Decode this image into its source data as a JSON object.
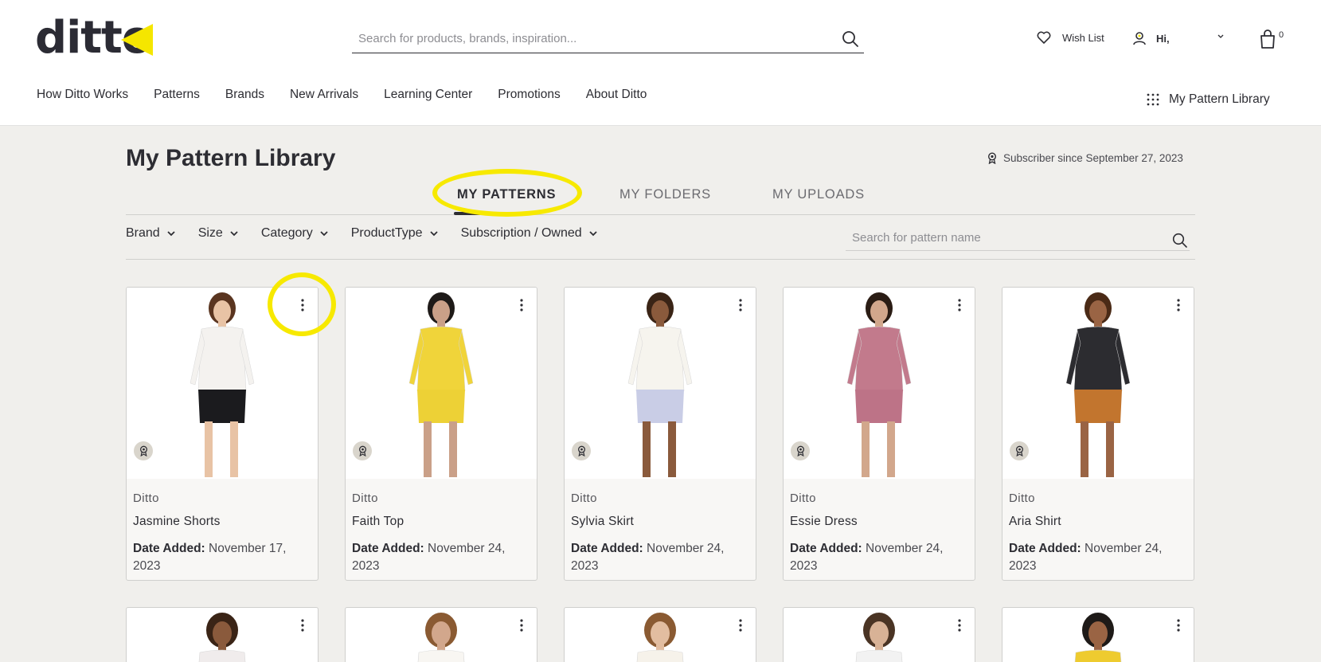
{
  "header": {
    "logo_text": "ditto",
    "search_placeholder": "Search for products, brands, inspiration...",
    "wish_list_label": "Wish List",
    "user_greeting": "Hi,",
    "cart_count": "0",
    "library_link": "My Pattern Library"
  },
  "nav": {
    "items": [
      "How Ditto Works",
      "Patterns",
      "Brands",
      "New Arrivals",
      "Learning Center",
      "Promotions",
      "About Ditto"
    ]
  },
  "page": {
    "title": "My Pattern Library",
    "subscriber_text": "Subscriber since September 27, 2023"
  },
  "tabs": [
    "MY PATTERNS",
    "MY FOLDERS",
    "MY UPLOADS"
  ],
  "filters": [
    "Brand",
    "Size",
    "Category",
    "ProductType",
    "Subscription / Owned"
  ],
  "pattern_search_placeholder": "Search for pattern name",
  "date_label": "Date Added:",
  "patterns": [
    {
      "brand": "Ditto",
      "name": "Jasmine Shorts",
      "date": "November 17, 2023",
      "top_color": "#f4f2ef",
      "bottom_color": "#1b1b1e",
      "skin": "#e8c3a5",
      "hair": "#5a3520"
    },
    {
      "brand": "Ditto",
      "name": "Faith Top",
      "date": "November 24, 2023",
      "top_color": "#f0d43a",
      "bottom_color": "#edd136",
      "skin": "#caa088",
      "hair": "#1e1a18"
    },
    {
      "brand": "Ditto",
      "name": "Sylvia Skirt",
      "date": "November 24, 2023",
      "top_color": "#f6f4ee",
      "bottom_color": "#c9cde6",
      "skin": "#8a5a3c",
      "hair": "#3a2416"
    },
    {
      "brand": "Ditto",
      "name": "Essie Dress",
      "date": "November 24, 2023",
      "top_color": "#c27a8c",
      "bottom_color": "#bd7387",
      "skin": "#d2a78c",
      "hair": "#2a1c14"
    },
    {
      "brand": "Ditto",
      "name": "Aria Shirt",
      "date": "November 24, 2023",
      "top_color": "#2c2c30",
      "bottom_color": "#c2752e",
      "skin": "#9a6444",
      "hair": "#4a2a16"
    }
  ],
  "next_row": [
    {
      "skin": "#8a5a3c",
      "hair": "#3a2416",
      "top_color": "#f0ecec"
    },
    {
      "skin": "#d2a78c",
      "hair": "#8a5a32",
      "top_color": "#f8f6f2"
    },
    {
      "skin": "#e2bda0",
      "hair": "#8a5a32",
      "top_color": "#f6f2ea"
    },
    {
      "skin": "#d8b296",
      "hair": "#4a3424",
      "top_color": "#f2f2f2"
    },
    {
      "skin": "#9a6444",
      "hair": "#1e1a18",
      "top_color": "#eecb2f"
    }
  ]
}
